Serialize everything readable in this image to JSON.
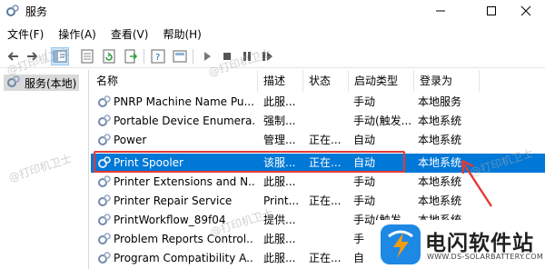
{
  "window": {
    "title": "服务",
    "controls": {
      "minimize": "—",
      "maximize": "☐",
      "close": "✕"
    }
  },
  "menu": [
    "文件(F)",
    "操作(A)",
    "查看(V)",
    "帮助(H)"
  ],
  "toolbar_icons": [
    "back-arrow-icon",
    "forward-arrow-icon",
    "console-tree-icon",
    "properties-icon",
    "refresh-icon",
    "export-list-icon",
    "help-icon",
    "view-icon",
    "start-service-icon",
    "stop-service-icon",
    "pause-service-icon",
    "restart-service-icon"
  ],
  "tree": {
    "label": "服务(本地)"
  },
  "columns": {
    "name": "名称",
    "desc": "描述",
    "status": "状态",
    "start": "启动类型",
    "logon": "登录为"
  },
  "rows": [
    {
      "name": "PNRP Machine Name Pu...",
      "desc": "此服...",
      "status": "",
      "start": "手动",
      "logon": "本地服务"
    },
    {
      "name": "Portable Device Enumera...",
      "desc": "强制...",
      "status": "",
      "start": "手动(触发...",
      "logon": "本地系统"
    },
    {
      "name": "Power",
      "desc": "管理...",
      "status": "正在...",
      "start": "自动",
      "logon": "本地系统"
    },
    {
      "name": "Print Spooler",
      "desc": "该服...",
      "status": "正在...",
      "start": "自动",
      "logon": "本地系统",
      "selected": true
    },
    {
      "name": "Printer Extensions and N...",
      "desc": "此服...",
      "status": "",
      "start": "手动",
      "logon": "本地系统"
    },
    {
      "name": "Printer Repair Service",
      "desc": "Print...",
      "status": "正在...",
      "start": "手动",
      "logon": "本地系统"
    },
    {
      "name": "PrintWorkflow_89f04",
      "desc": "提供...",
      "status": "",
      "start": "手动(触发...",
      "logon": "本地系统"
    },
    {
      "name": "Problem Reports Control...",
      "desc": "此服...",
      "status": "",
      "start": "手",
      "logon": ""
    },
    {
      "name": "Program Compatibility A...",
      "desc": "此服...",
      "status": "正在...",
      "start": "自",
      "logon": ""
    }
  ],
  "watermarks": [
    "@打印机卫士",
    "@打印机卫士",
    "@打印机卫士",
    "@打印机卫士",
    "@打印机卫士"
  ],
  "logo": {
    "cn": "电闪软件站",
    "en": "WWW.DS-SOLARBATTERY.COM"
  },
  "colors": {
    "selection": "#0078d7",
    "highlight_box": "#e53935",
    "arrow": "#e53935",
    "logo_blue": "#1e88e5",
    "logo_orange": "#f39c12"
  }
}
